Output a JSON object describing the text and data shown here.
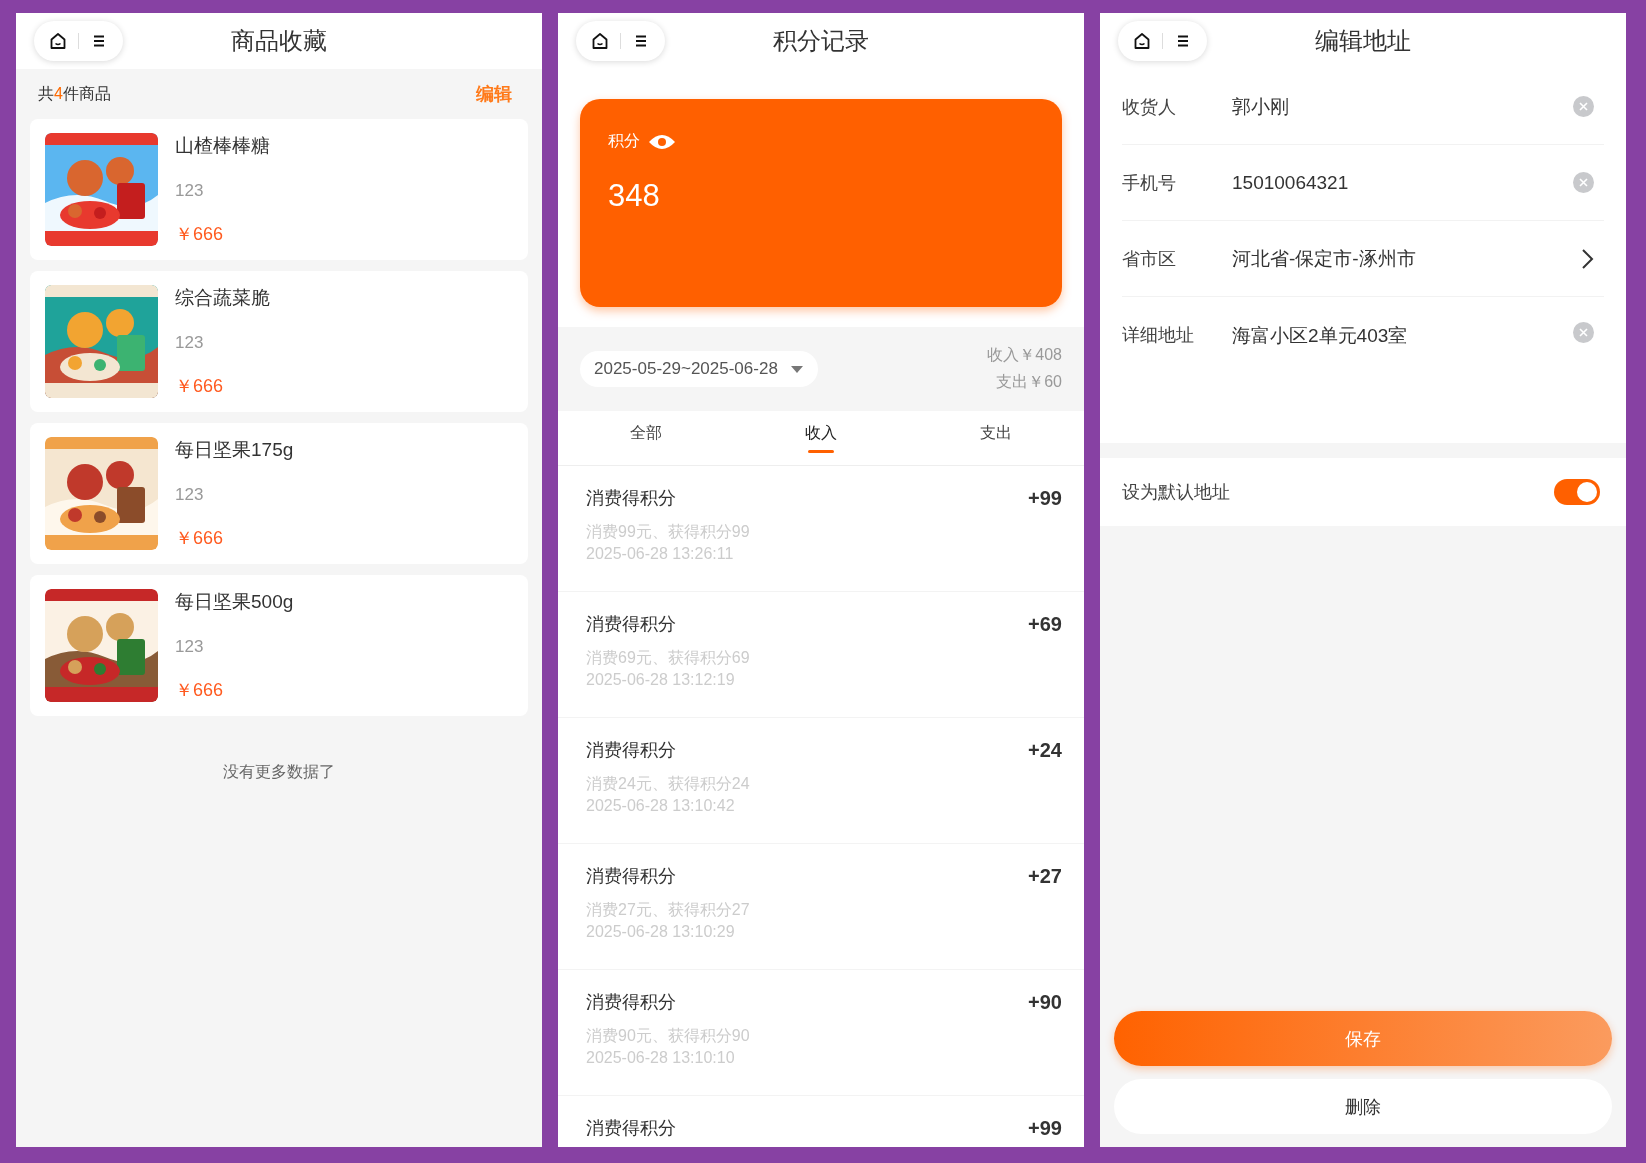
{
  "favorites": {
    "title": "商品收藏",
    "summary_prefix": "共",
    "count": "4",
    "summary_suffix": "件商品",
    "edit": "编辑",
    "items": [
      {
        "name": "山楂棒棒糖",
        "subtitle": "123",
        "price": "￥666"
      },
      {
        "name": "综合蔬菜脆",
        "subtitle": "123",
        "price": "￥666"
      },
      {
        "name": "每日坚果175g",
        "subtitle": "123",
        "price": "￥666"
      },
      {
        "name": "每日坚果500g",
        "subtitle": "123",
        "price": "￥666"
      }
    ],
    "footer": "没有更多数据了"
  },
  "points": {
    "title": "积分记录",
    "balance_label": "积分",
    "balance": "348",
    "date_range": "2025-05-29~2025-06-28",
    "income": "收入￥408",
    "expense": "支出￥60",
    "tabs": [
      {
        "label": "全部",
        "selected": false
      },
      {
        "label": "收入",
        "selected": true
      },
      {
        "label": "支出",
        "selected": false
      }
    ],
    "records": [
      {
        "title": "消费得积分",
        "amount": "+99",
        "desc": "消费99元、获得积分99",
        "time": "2025-06-28 13:26:11"
      },
      {
        "title": "消费得积分",
        "amount": "+69",
        "desc": "消费69元、获得积分69",
        "time": "2025-06-28 13:12:19"
      },
      {
        "title": "消费得积分",
        "amount": "+24",
        "desc": "消费24元、获得积分24",
        "time": "2025-06-28 13:10:42"
      },
      {
        "title": "消费得积分",
        "amount": "+27",
        "desc": "消费27元、获得积分27",
        "time": "2025-06-28 13:10:29"
      },
      {
        "title": "消费得积分",
        "amount": "+90",
        "desc": "消费90元、获得积分90",
        "time": "2025-06-28 13:10:10"
      },
      {
        "title": "消费得积分",
        "amount": "+99"
      }
    ]
  },
  "address": {
    "title": "编辑地址",
    "fields": [
      {
        "label": "收货人",
        "value": "郭小刚",
        "kind": "clearable"
      },
      {
        "label": "手机号",
        "value": "15010064321",
        "kind": "clearable"
      },
      {
        "label": "省市区",
        "value": "河北省-保定市-涿州市",
        "kind": "picker"
      },
      {
        "label": "详细地址",
        "value": "海富小区2单元403室",
        "kind": "textarea"
      }
    ],
    "default": {
      "label": "设为默认地址",
      "on": true
    },
    "save": "保存",
    "delete": "删除"
  }
}
